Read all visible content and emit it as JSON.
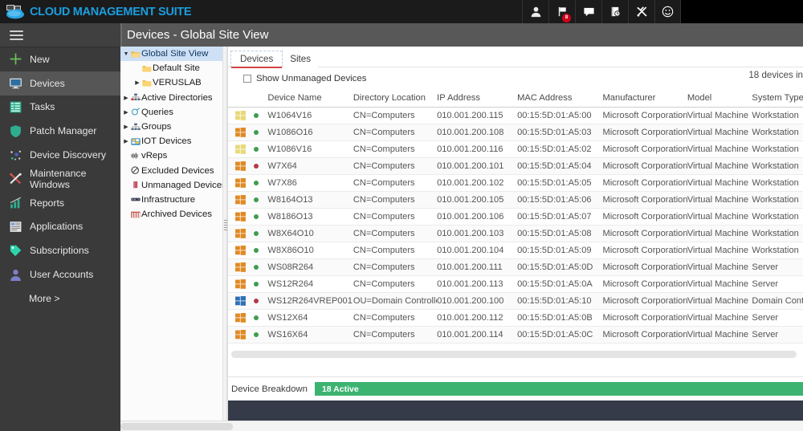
{
  "topbar": {
    "brand": "CLOUD MANAGEMENT SUITE",
    "brand_color": "#1a9ee0",
    "background": "#1b1b1b",
    "icons": [
      {
        "name": "user-icon",
        "glyph": "⚘",
        "badge": null
      },
      {
        "name": "flag-icon",
        "glyph": "⚑",
        "badge": "8"
      },
      {
        "name": "chat-icon",
        "glyph": "▭",
        "badge": null
      },
      {
        "name": "book-history-icon",
        "glyph": "◱",
        "badge": null
      },
      {
        "name": "tools-icon",
        "glyph": "⚒",
        "badge": null
      },
      {
        "name": "smiley-icon",
        "glyph": "☺",
        "badge": null
      }
    ]
  },
  "sidebar": {
    "background": "#3a3a3a",
    "menu_icon": "hamburger-icon",
    "items": [
      {
        "label": "New",
        "icon": "plus-icon",
        "active": false
      },
      {
        "label": "Devices",
        "icon": "monitor-icon",
        "active": true
      },
      {
        "label": "Tasks",
        "icon": "tasks-icon",
        "active": false
      },
      {
        "label": "Patch Manager",
        "icon": "shield-icon",
        "active": false
      },
      {
        "label": "Device Discovery",
        "icon": "discovery-dots-icon",
        "active": false
      },
      {
        "label": "Maintenance Windows",
        "icon": "wrench-cross-icon",
        "active": false
      },
      {
        "label": "Reports",
        "icon": "bar-chart-icon",
        "active": false
      },
      {
        "label": "Applications",
        "icon": "applications-icon",
        "active": false
      },
      {
        "label": "Subscriptions",
        "icon": "tag-icon",
        "active": false
      },
      {
        "label": "User Accounts",
        "icon": "person-icon",
        "active": false
      }
    ],
    "more_label": "More >"
  },
  "page": {
    "title": "Devices - Global Site View"
  },
  "tree": {
    "nodes": [
      {
        "label": "Global Site View",
        "icon": "folder-open-icon",
        "indent": 0,
        "twisty": "down",
        "selected": true
      },
      {
        "label": "Default Site",
        "icon": "folder-icon",
        "indent": 1,
        "twisty": "none",
        "selected": false
      },
      {
        "label": "VERUSLAB",
        "icon": "folder-icon",
        "indent": 1,
        "twisty": "right",
        "selected": false
      },
      {
        "label": "Active Directories",
        "icon": "org-tree-icon",
        "indent": 0,
        "twisty": "right",
        "selected": false
      },
      {
        "label": "Queries",
        "icon": "query-icon",
        "indent": 0,
        "twisty": "right",
        "selected": false
      },
      {
        "label": "Groups",
        "icon": "groups-icon",
        "indent": 0,
        "twisty": "right",
        "selected": false
      },
      {
        "label": "IOT Devices",
        "icon": "iot-icon",
        "indent": 0,
        "twisty": "right",
        "selected": false
      },
      {
        "label": "vReps",
        "icon": "vreps-icon",
        "indent": 0,
        "twisty": "none",
        "selected": false
      },
      {
        "label": "Excluded Devices",
        "icon": "no-entry-icon",
        "indent": 0,
        "twisty": "none",
        "selected": false
      },
      {
        "label": "Unmanaged Devices",
        "icon": "unmanaged-icon",
        "indent": 0,
        "twisty": "none",
        "selected": false
      },
      {
        "label": "Infrastructure",
        "icon": "infrastructure-icon",
        "indent": 0,
        "twisty": "none",
        "selected": false
      },
      {
        "label": "Archived Devices",
        "icon": "archive-icon",
        "indent": 0,
        "twisty": "none",
        "selected": false
      }
    ]
  },
  "main": {
    "tabs": [
      {
        "label": "Devices",
        "active": true
      },
      {
        "label": "Sites",
        "active": false
      }
    ],
    "show_unmanaged_label": "Show Unmanaged Devices",
    "show_unmanaged_checked": false,
    "device_count_text": "18 devices in",
    "columns": [
      "Device Name",
      "Directory Location",
      "IP Address",
      "MAC Address",
      "Manufacturer",
      "Model",
      "System Type"
    ],
    "rows": [
      {
        "os_icon": "windows-logo-icon",
        "os_color": "#e8d87a",
        "status": "online",
        "status_color": "#3f9c4f",
        "name": "W1064V16",
        "dir": "CN=Computers",
        "ip": "010.001.200.115",
        "mac": "00:15:5D:01:A5:00",
        "manufacturer": "Microsoft Corporation",
        "model": "Virtual Machine",
        "system": "Workstation"
      },
      {
        "os_icon": "windows-logo-icon",
        "os_color": "#e08a25",
        "status": "online",
        "status_color": "#3f9c4f",
        "name": "W1086O16",
        "dir": "CN=Computers",
        "ip": "010.001.200.108",
        "mac": "00:15:5D:01:A5:03",
        "manufacturer": "Microsoft Corporation",
        "model": "Virtual Machine",
        "system": "Workstation"
      },
      {
        "os_icon": "windows-logo-icon",
        "os_color": "#e8d87a",
        "status": "online",
        "status_color": "#3f9c4f",
        "name": "W1086V16",
        "dir": "CN=Computers",
        "ip": "010.001.200.116",
        "mac": "00:15:5D:01:A5:02",
        "manufacturer": "Microsoft Corporation",
        "model": "Virtual Machine",
        "system": "Workstation"
      },
      {
        "os_icon": "windows-logo-icon",
        "os_color": "#e08a25",
        "status": "offline",
        "status_color": "#b33a48",
        "name": "W7X64",
        "dir": "CN=Computers",
        "ip": "010.001.200.101",
        "mac": "00:15:5D:01:A5:04",
        "manufacturer": "Microsoft Corporation",
        "model": "Virtual Machine",
        "system": "Workstation"
      },
      {
        "os_icon": "windows-logo-icon",
        "os_color": "#e08a25",
        "status": "online",
        "status_color": "#3f9c4f",
        "name": "W7X86",
        "dir": "CN=Computers",
        "ip": "010.001.200.102",
        "mac": "00:15:5D:01:A5:05",
        "manufacturer": "Microsoft Corporation",
        "model": "Virtual Machine",
        "system": "Workstation"
      },
      {
        "os_icon": "windows-logo-icon",
        "os_color": "#e08a25",
        "status": "online",
        "status_color": "#3f9c4f",
        "name": "W8164O13",
        "dir": "CN=Computers",
        "ip": "010.001.200.105",
        "mac": "00:15:5D:01:A5:06",
        "manufacturer": "Microsoft Corporation",
        "model": "Virtual Machine",
        "system": "Workstation"
      },
      {
        "os_icon": "windows-logo-icon",
        "os_color": "#e08a25",
        "status": "online",
        "status_color": "#3f9c4f",
        "name": "W8186O13",
        "dir": "CN=Computers",
        "ip": "010.001.200.106",
        "mac": "00:15:5D:01:A5:07",
        "manufacturer": "Microsoft Corporation",
        "model": "Virtual Machine",
        "system": "Workstation"
      },
      {
        "os_icon": "windows-logo-icon",
        "os_color": "#e08a25",
        "status": "online",
        "status_color": "#3f9c4f",
        "name": "W8X64O10",
        "dir": "CN=Computers",
        "ip": "010.001.200.103",
        "mac": "00:15:5D:01:A5:08",
        "manufacturer": "Microsoft Corporation",
        "model": "Virtual Machine",
        "system": "Workstation"
      },
      {
        "os_icon": "windows-logo-icon",
        "os_color": "#e08a25",
        "status": "online",
        "status_color": "#3f9c4f",
        "name": "W8X86O10",
        "dir": "CN=Computers",
        "ip": "010.001.200.104",
        "mac": "00:15:5D:01:A5:09",
        "manufacturer": "Microsoft Corporation",
        "model": "Virtual Machine",
        "system": "Workstation"
      },
      {
        "os_icon": "windows-logo-icon",
        "os_color": "#e08a25",
        "status": "online",
        "status_color": "#3f9c4f",
        "name": "WS08R264",
        "dir": "CN=Computers",
        "ip": "010.001.200.111",
        "mac": "00:15:5D:01:A5:0D",
        "manufacturer": "Microsoft Corporation",
        "model": "Virtual Machine",
        "system": "Server"
      },
      {
        "os_icon": "windows-logo-icon",
        "os_color": "#e08a25",
        "status": "online",
        "status_color": "#3f9c4f",
        "name": "WS12R264",
        "dir": "CN=Computers",
        "ip": "010.001.200.113",
        "mac": "00:15:5D:01:A5:0A",
        "manufacturer": "Microsoft Corporation",
        "model": "Virtual Machine",
        "system": "Server"
      },
      {
        "os_icon": "windows-logo-icon",
        "os_color": "#2f6fb5",
        "status": "offline",
        "status_color": "#b33a48",
        "name": "WS12R264VREP001",
        "dir": "OU=Domain Controllers",
        "ip": "010.001.200.100",
        "mac": "00:15:5D:01:A5:10",
        "manufacturer": "Microsoft Corporation",
        "model": "Virtual Machine",
        "system": "Domain Controller"
      },
      {
        "os_icon": "windows-logo-icon",
        "os_color": "#e08a25",
        "status": "online",
        "status_color": "#3f9c4f",
        "name": "WS12X64",
        "dir": "CN=Computers",
        "ip": "010.001.200.112",
        "mac": "00:15:5D:01:A5:0B",
        "manufacturer": "Microsoft Corporation",
        "model": "Virtual Machine",
        "system": "Server"
      },
      {
        "os_icon": "windows-logo-icon",
        "os_color": "#e08a25",
        "status": "online",
        "status_color": "#3f9c4f",
        "name": "WS16X64",
        "dir": "CN=Computers",
        "ip": "010.001.200.114",
        "mac": "00:15:5D:01:A5:0C",
        "manufacturer": "Microsoft Corporation",
        "model": "Virtual Machine",
        "system": "Server"
      }
    ]
  },
  "breakdown": {
    "label": "Device Breakdown",
    "segment_label": "18 Active",
    "segment_color": "#3cb371"
  }
}
